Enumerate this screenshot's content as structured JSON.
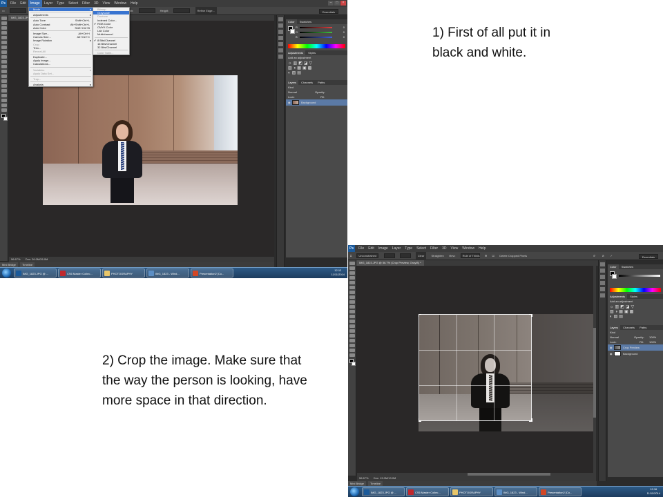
{
  "captions": {
    "step1": "1) First of all put it in black and white.",
    "step2": "2) Crop the image. Make sure that the way the person is looking, have more space in that direction."
  },
  "ps1": {
    "menu": [
      "Ps",
      "File",
      "Edit",
      "Image",
      "Layer",
      "Type",
      "Select",
      "Filter",
      "3D",
      "View",
      "Window",
      "Help"
    ],
    "options": {
      "width": "Width:",
      "height": "Height:",
      "refine": "Refine Edge...",
      "workspace": "Essentials"
    },
    "doc_tab": "IMG_1823.JPG @",
    "image_menu": [
      {
        "label": "Mode",
        "shortcut": "",
        "highlight": true,
        "sub": true
      },
      {
        "sep": true
      },
      {
        "label": "Adjustments",
        "shortcut": "",
        "sub": true
      },
      {
        "sep": true
      },
      {
        "label": "Auto Tone",
        "shortcut": "Shift+Ctrl+L"
      },
      {
        "label": "Auto Contrast",
        "shortcut": "Alt+Shift+Ctrl+L"
      },
      {
        "label": "Auto Color",
        "shortcut": "Shift+Ctrl+B"
      },
      {
        "sep": true
      },
      {
        "label": "Image Size...",
        "shortcut": "Alt+Ctrl+I"
      },
      {
        "label": "Canvas Size...",
        "shortcut": "Alt+Ctrl+C"
      },
      {
        "label": "Image Rotation",
        "shortcut": "",
        "sub": true
      },
      {
        "label": "Crop",
        "shortcut": "",
        "disabled": true
      },
      {
        "label": "Trim...",
        "shortcut": ""
      },
      {
        "label": "Reveal All",
        "shortcut": "",
        "disabled": true
      },
      {
        "sep": true
      },
      {
        "label": "Duplicate...",
        "shortcut": ""
      },
      {
        "label": "Apply Image...",
        "shortcut": ""
      },
      {
        "label": "Calculations...",
        "shortcut": ""
      },
      {
        "sep": true
      },
      {
        "label": "Variables",
        "shortcut": "",
        "sub": true,
        "disabled": true
      },
      {
        "label": "Apply Data Set...",
        "shortcut": "",
        "disabled": true
      },
      {
        "sep": true
      },
      {
        "label": "Trap...",
        "shortcut": "",
        "disabled": true
      },
      {
        "sep": true
      },
      {
        "label": "Analysis",
        "shortcut": "",
        "sub": true
      }
    ],
    "mode_menu": [
      {
        "label": "Bitmap",
        "disabled": true
      },
      {
        "label": "Grayscale",
        "highlight": true
      },
      {
        "label": "Duotone",
        "disabled": true
      },
      {
        "label": "Indexed Color..."
      },
      {
        "label": "RGB Color",
        "checked": true
      },
      {
        "label": "CMYK Color"
      },
      {
        "label": "Lab Color"
      },
      {
        "label": "Multichannel"
      },
      {
        "sep": true
      },
      {
        "label": "8 Bits/Channel",
        "checked": true
      },
      {
        "label": "16 Bits/Channel"
      },
      {
        "label": "32 Bits/Channel"
      },
      {
        "sep": true
      },
      {
        "label": "Color Table...",
        "disabled": true
      }
    ],
    "panels": {
      "color_tabs": [
        "Color",
        "Swatches"
      ],
      "channels": [
        {
          "label": "R",
          "value": "0",
          "color": "#e04040"
        },
        {
          "label": "G",
          "value": "0",
          "color": "#40c040"
        },
        {
          "label": "B",
          "value": "0",
          "color": "#4060e0"
        }
      ],
      "adj_tabs": [
        "Adjustments",
        "Styles"
      ],
      "adj_title": "Add an adjustment",
      "layers_tabs": [
        "Layers",
        "Channels",
        "Paths"
      ],
      "kind": "Kind",
      "blend": "Normal",
      "opacity_label": "Opacity:",
      "lock_label": "Lock:",
      "fill_label": "Fill:",
      "layers": [
        {
          "name": "Background",
          "selected": true
        }
      ]
    },
    "status": {
      "zoom": "56.67%",
      "doc": "Doc: 26.0M/26.0M"
    },
    "bottom_tabs": [
      "Mini Bridge",
      "Timeline"
    ]
  },
  "ps2": {
    "menu": [
      "Ps",
      "File",
      "Edit",
      "Image",
      "Layer",
      "Type",
      "Select",
      "Filter",
      "3D",
      "View",
      "Window",
      "Help"
    ],
    "options": {
      "ratio": "Unconstrained",
      "straighten": "Straighten",
      "view": "View:",
      "overlay": "Rule of Thirds",
      "delete": "Delete Cropped Pixels",
      "workspace": "Essentials"
    },
    "doc_tab": "IMG_1823.JPG @ 56.7% (Crop Preview, Gray/8) *",
    "panels": {
      "color_tabs": [
        "Color",
        "Swatches"
      ],
      "adj_tabs": [
        "Adjustments",
        "Styles"
      ],
      "adj_title": "Add an adjustment",
      "layers_tabs": [
        "Layers",
        "Channels",
        "Paths"
      ],
      "kind": "Kind",
      "blend": "Normal",
      "opacity_label": "Opacity:",
      "opacity_value": "100%",
      "lock_label": "Lock:",
      "fill_label": "Fill:",
      "fill_value": "100%",
      "layers": [
        {
          "name": "Crop Preview",
          "selected": true
        },
        {
          "name": "Background",
          "selected": false
        }
      ]
    },
    "status": {
      "zoom": "56.67%",
      "doc": "Doc: 13.0M/13.0M"
    },
    "bottom_tabs": [
      "Mini Bridge",
      "Timeline"
    ]
  },
  "taskbar1": {
    "items": [
      {
        "label": "IMG_1823.JPG @ ...",
        "color": "#1b5a9a"
      },
      {
        "label": "CS6 Master Collec...",
        "color": "#c0282d"
      },
      {
        "label": "PHOTOGRAPHY",
        "color": "#e8c66a"
      },
      {
        "label": "IMG_1823 - Wind...",
        "color": "#5c8ec4"
      },
      {
        "label": "Presentation2 [Co...",
        "color": "#d24726"
      }
    ],
    "time": "12:12",
    "date": "11/11/2014"
  },
  "taskbar2": {
    "items": [
      {
        "label": "IMG_1823.JPG @ ...",
        "color": "#1b5a9a"
      },
      {
        "label": "CS6 Master Collec...",
        "color": "#c0282d"
      },
      {
        "label": "PHOTOGRAPHY",
        "color": "#e8c66a"
      },
      {
        "label": "IMG_1823 - Wind...",
        "color": "#5c8ec4"
      },
      {
        "label": "Presentation2 [Co...",
        "color": "#d24726"
      }
    ],
    "time": "12:16",
    "date": "11/11/2014"
  }
}
